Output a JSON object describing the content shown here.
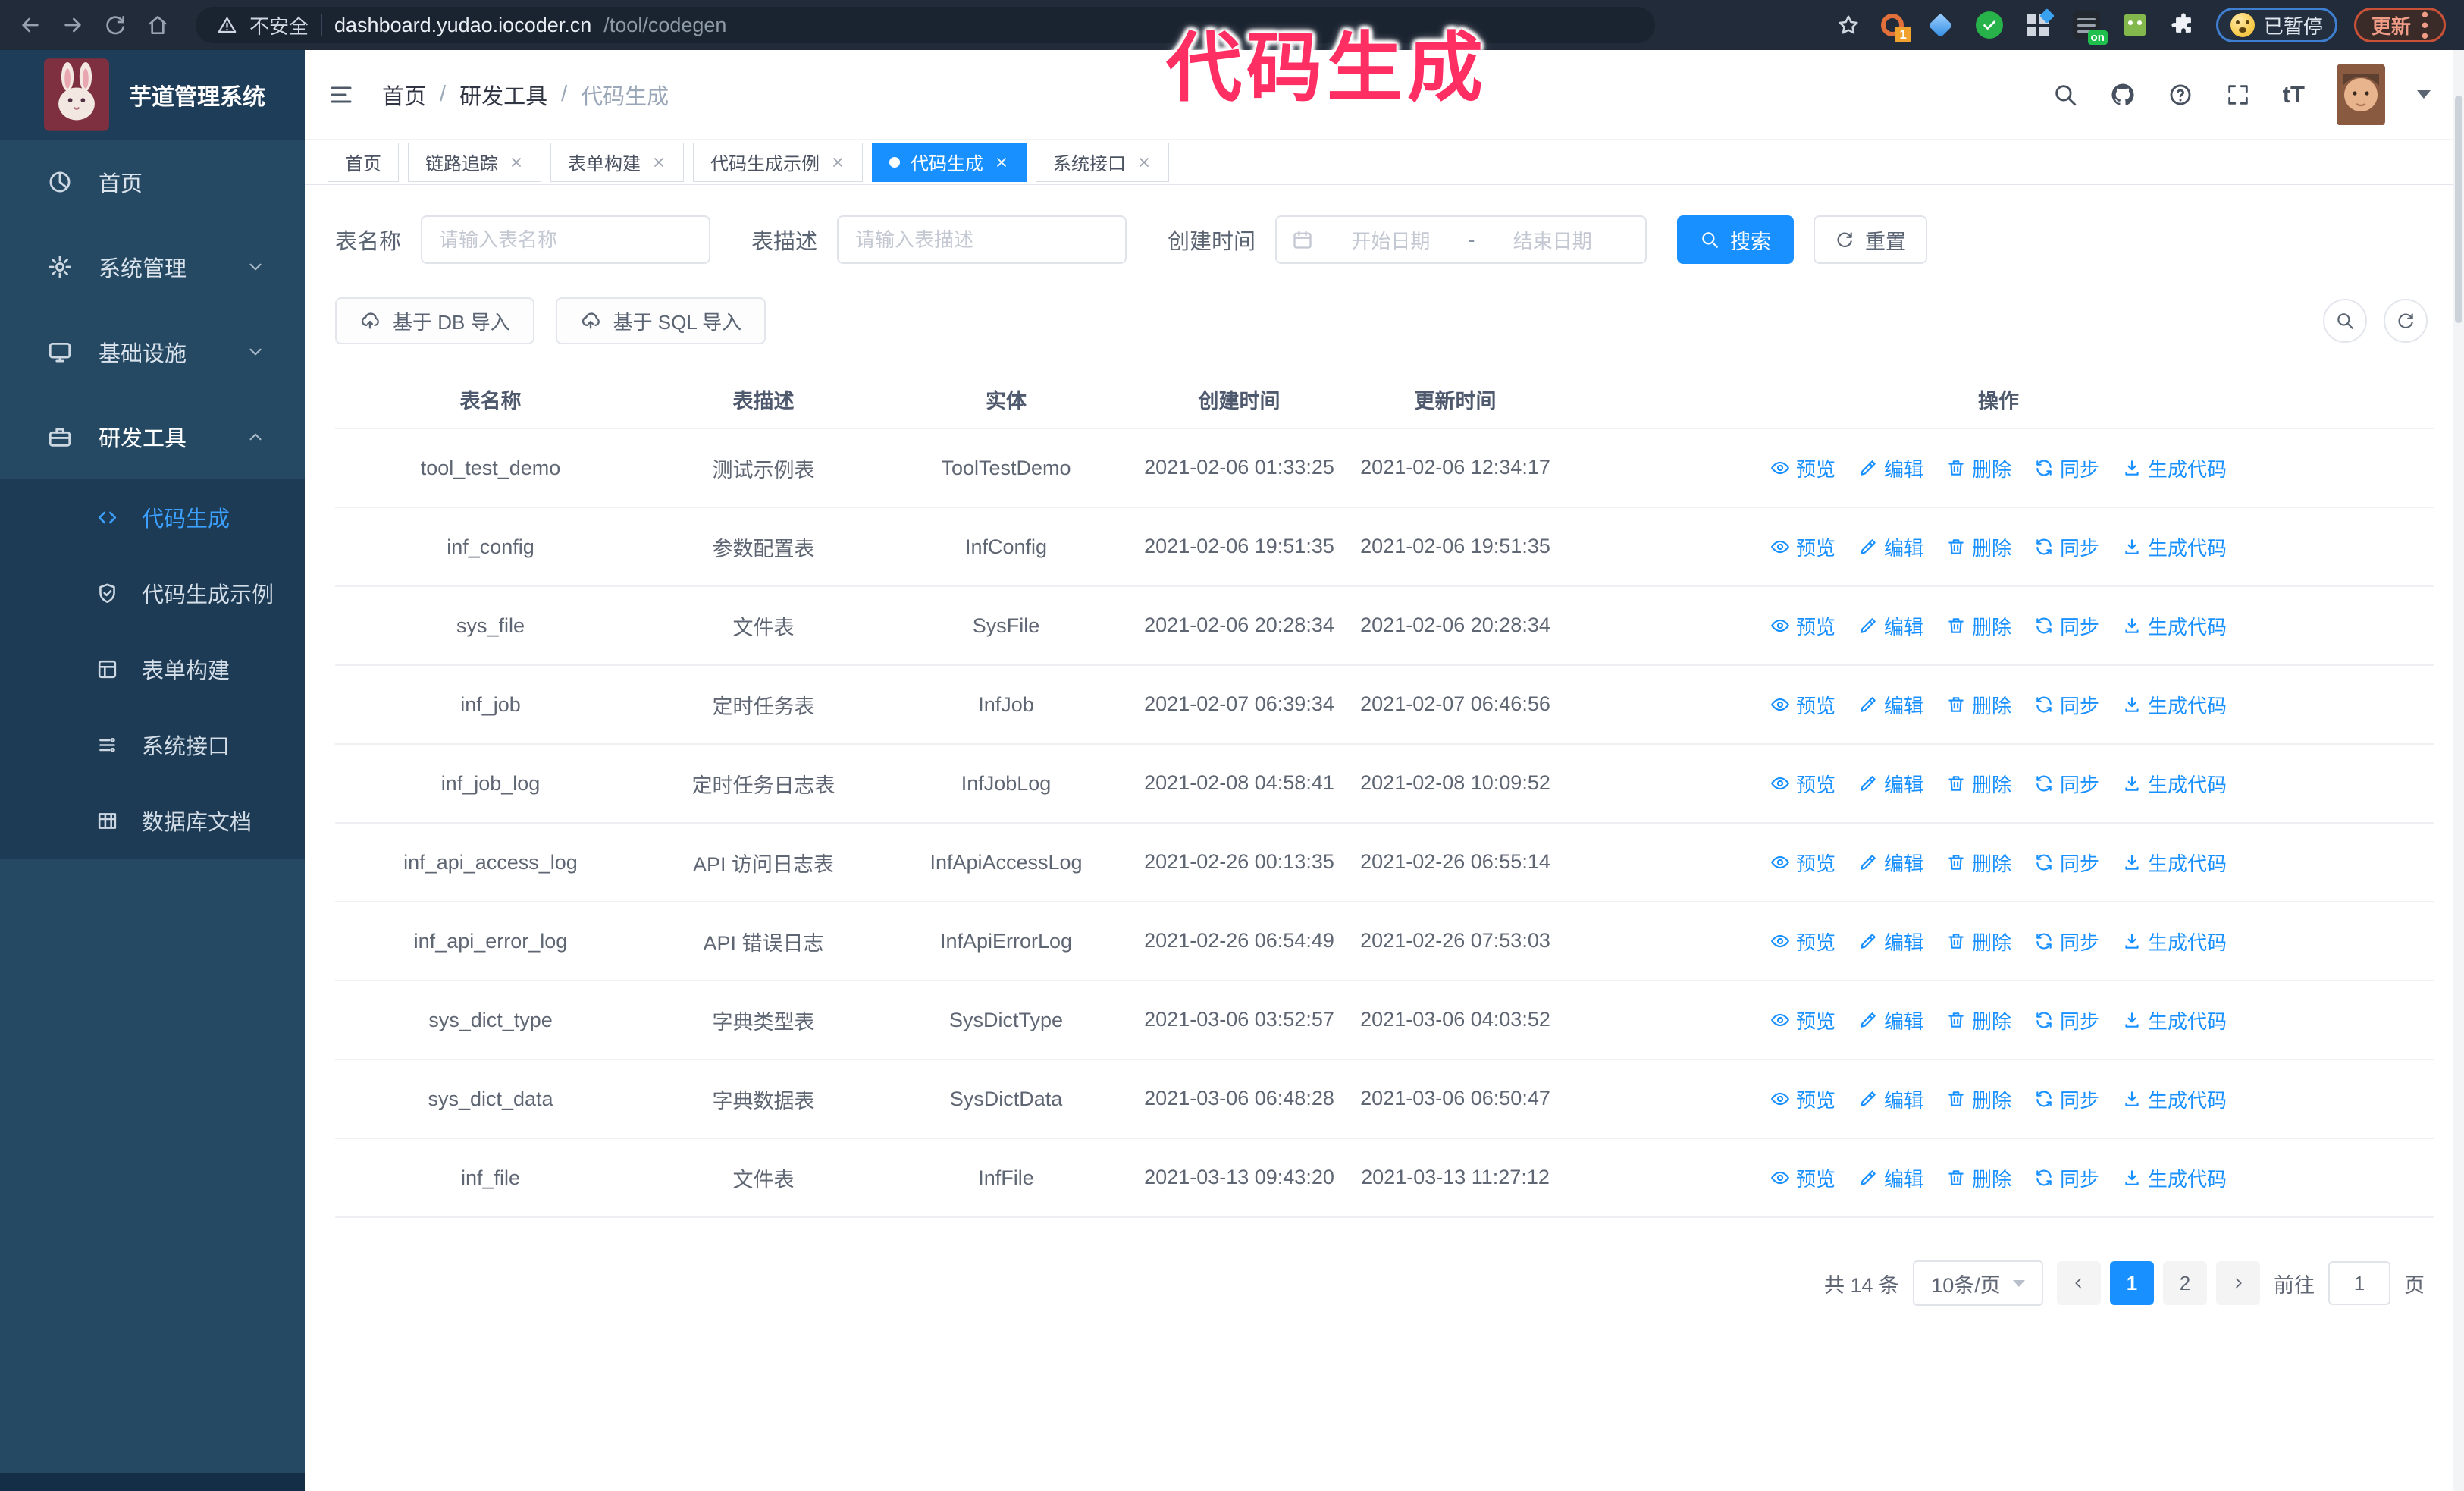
{
  "colors": {
    "primary": "#1890ff",
    "sidebar_bg": "#254963",
    "annotation": "#ff2e63",
    "chrome_bg": "#212b39"
  },
  "browser": {
    "security_label": "不安全",
    "url_host": "dashboard.yudao.iocoder.cn",
    "url_path": "/tool/codegen",
    "extension_count_badge": "1",
    "extension_on_badge": "on",
    "paused_label": "已暂停",
    "update_label": "更新"
  },
  "annotation": {
    "text": "代码生成"
  },
  "sidebar": {
    "logo_title": "芋道管理系统",
    "items": [
      {
        "id": "home",
        "label": "首页",
        "icon": "dashboard-icon",
        "chevron": "",
        "expanded": false
      },
      {
        "id": "system",
        "label": "系统管理",
        "icon": "gear-icon",
        "chevron": "down",
        "expanded": false
      },
      {
        "id": "infra",
        "label": "基础设施",
        "icon": "infra-icon",
        "chevron": "down",
        "expanded": false
      },
      {
        "id": "devtools",
        "label": "研发工具",
        "icon": "tools-icon",
        "chevron": "up",
        "expanded": true
      }
    ],
    "sub_items": [
      {
        "id": "codegen",
        "label": "代码生成",
        "icon": "code-icon",
        "active": true
      },
      {
        "id": "codegen-example",
        "label": "代码生成示例",
        "icon": "shield-icon",
        "active": false
      },
      {
        "id": "form-builder",
        "label": "表单构建",
        "icon": "form-icon",
        "active": false
      },
      {
        "id": "api",
        "label": "系统接口",
        "icon": "api-icon",
        "active": false
      },
      {
        "id": "db-doc",
        "label": "数据库文档",
        "icon": "dbdoc-icon",
        "active": false
      }
    ]
  },
  "header": {
    "breadcrumb": [
      "首页",
      "研发工具",
      "代码生成"
    ],
    "breadcrumb_separator": "/"
  },
  "glyphs": {
    "font_size": "tT"
  },
  "tabs": [
    {
      "label": "首页",
      "closable": false,
      "active": false
    },
    {
      "label": "链路追踪",
      "closable": true,
      "active": false
    },
    {
      "label": "表单构建",
      "closable": true,
      "active": false
    },
    {
      "label": "代码生成示例",
      "closable": true,
      "active": false
    },
    {
      "label": "代码生成",
      "closable": true,
      "active": true
    },
    {
      "label": "系统接口",
      "closable": true,
      "active": false
    }
  ],
  "filters": {
    "name_label": "表名称",
    "name_placeholder": "请输入表名称",
    "desc_label": "表描述",
    "desc_placeholder": "请输入表描述",
    "date_label": "创建时间",
    "date_start_placeholder": "开始日期",
    "date_separator": "-",
    "date_end_placeholder": "结束日期",
    "search_label": "搜索",
    "reset_label": "重置"
  },
  "toolbar": {
    "import_db_label": "基于 DB 导入",
    "import_sql_label": "基于 SQL 导入"
  },
  "table": {
    "columns": [
      "表名称",
      "表描述",
      "实体",
      "创建时间",
      "更新时间",
      "操作"
    ],
    "actions": [
      {
        "id": "preview",
        "label": "预览",
        "icon": "eye-icon"
      },
      {
        "id": "edit",
        "label": "编辑",
        "icon": "edit-icon"
      },
      {
        "id": "delete",
        "label": "删除",
        "icon": "delete-icon"
      },
      {
        "id": "sync",
        "label": "同步",
        "icon": "sync-icon"
      },
      {
        "id": "generate",
        "label": "生成代码",
        "icon": "download-icon"
      }
    ],
    "rows": [
      {
        "name": "tool_test_demo",
        "desc": "测试示例表",
        "entity": "ToolTestDemo",
        "created": "2021-02-06 01:33:25",
        "updated": "2021-02-06 12:34:17"
      },
      {
        "name": "inf_config",
        "desc": "参数配置表",
        "entity": "InfConfig",
        "created": "2021-02-06 19:51:35",
        "updated": "2021-02-06 19:51:35"
      },
      {
        "name": "sys_file",
        "desc": "文件表",
        "entity": "SysFile",
        "created": "2021-02-06 20:28:34",
        "updated": "2021-02-06 20:28:34"
      },
      {
        "name": "inf_job",
        "desc": "定时任务表",
        "entity": "InfJob",
        "created": "2021-02-07 06:39:34",
        "updated": "2021-02-07 06:46:56"
      },
      {
        "name": "inf_job_log",
        "desc": "定时任务日志表",
        "entity": "InfJobLog",
        "created": "2021-02-08 04:58:41",
        "updated": "2021-02-08 10:09:52"
      },
      {
        "name": "inf_api_access_log",
        "desc": "API 访问日志表",
        "entity": "InfApiAccessLog",
        "created": "2021-02-26 00:13:35",
        "updated": "2021-02-26 06:55:14"
      },
      {
        "name": "inf_api_error_log",
        "desc": "API 错误日志",
        "entity": "InfApiErrorLog",
        "created": "2021-02-26 06:54:49",
        "updated": "2021-02-26 07:53:03"
      },
      {
        "name": "sys_dict_type",
        "desc": "字典类型表",
        "entity": "SysDictType",
        "created": "2021-03-06 03:52:57",
        "updated": "2021-03-06 04:03:52"
      },
      {
        "name": "sys_dict_data",
        "desc": "字典数据表",
        "entity": "SysDictData",
        "created": "2021-03-06 06:48:28",
        "updated": "2021-03-06 06:50:47"
      },
      {
        "name": "inf_file",
        "desc": "文件表",
        "entity": "InfFile",
        "created": "2021-03-13 09:43:20",
        "updated": "2021-03-13 11:27:12"
      }
    ]
  },
  "pagination": {
    "total_label": "共 14 条",
    "page_size_label": "10条/页",
    "pages": [
      {
        "label": "1",
        "active": true
      },
      {
        "label": "2",
        "active": false
      }
    ],
    "goto_label": "前往",
    "goto_value": "1",
    "unit_label": "页"
  }
}
